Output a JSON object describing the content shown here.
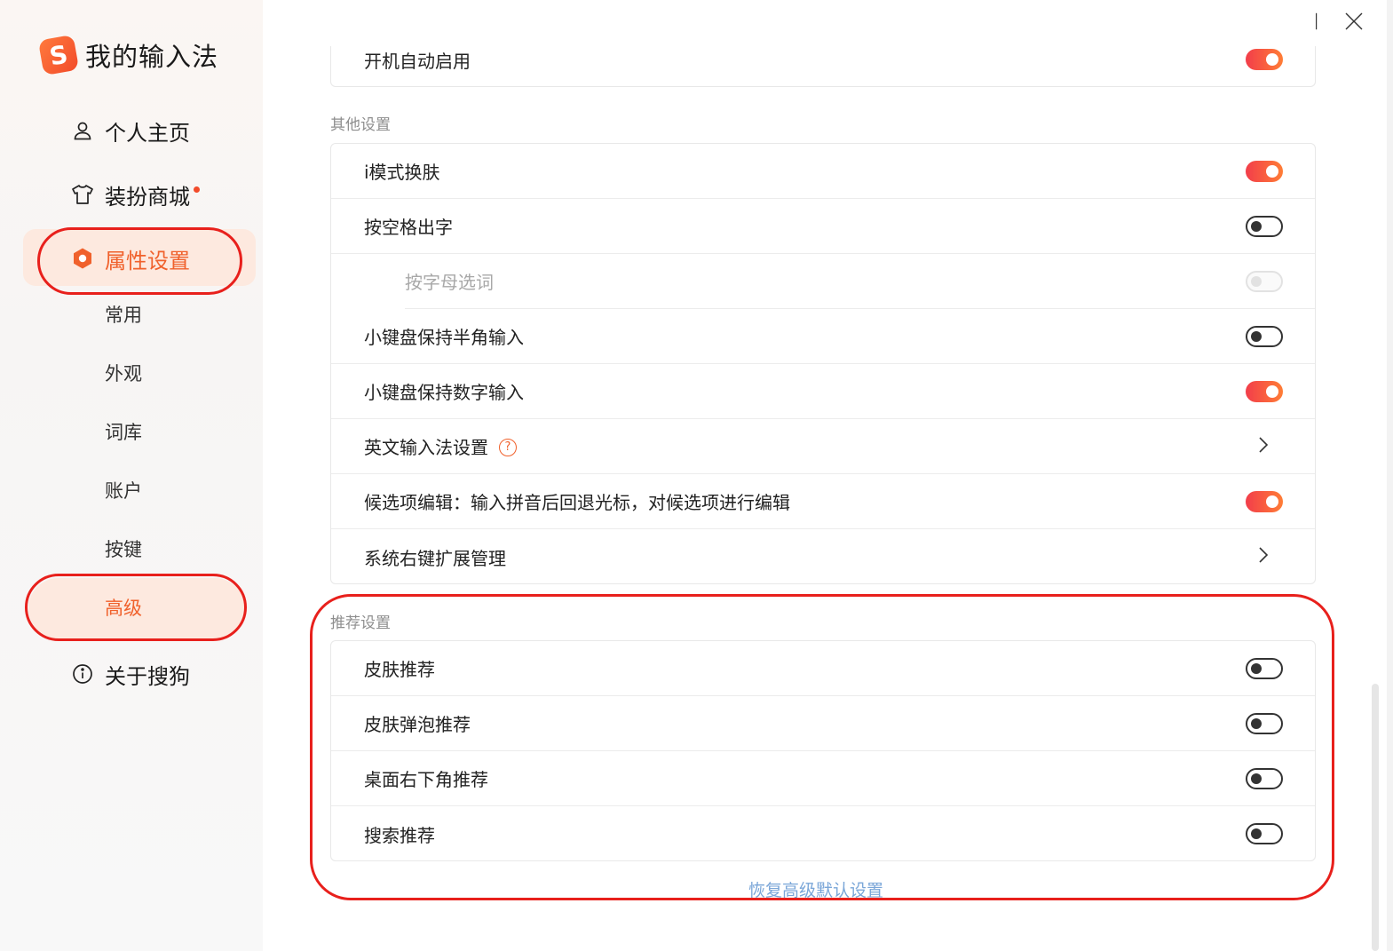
{
  "brand": {
    "logo_letter": "S",
    "title": "我的输入法"
  },
  "nav": {
    "profile": "个人主页",
    "store": "装扮商城",
    "settings": "属性设置",
    "about": "关于搜狗"
  },
  "subnav": [
    "常用",
    "外观",
    "词库",
    "账户",
    "按键",
    "高级"
  ],
  "top_partial_row": {
    "label": "开机自动启用",
    "toggle": "on"
  },
  "sections": {
    "other": {
      "title": "其他设置",
      "rows": [
        {
          "label": "i模式换肤",
          "control": "toggle",
          "state": "on"
        },
        {
          "label": "按空格出字",
          "control": "toggle",
          "state": "off"
        },
        {
          "label": "按字母选词",
          "control": "toggle",
          "state": "disabled"
        },
        {
          "label": "小键盘保持半角输入",
          "control": "toggle",
          "state": "off"
        },
        {
          "label": "小键盘保持数字输入",
          "control": "toggle",
          "state": "on"
        },
        {
          "label": "英文输入法设置",
          "control": "chevron",
          "help": "?"
        },
        {
          "label": "候选项编辑：输入拼音后回退光标，对候选项进行编辑",
          "control": "toggle",
          "state": "on"
        },
        {
          "label": "系统右键扩展管理",
          "control": "chevron"
        }
      ]
    },
    "recommend": {
      "title": "推荐设置",
      "rows": [
        {
          "label": "皮肤推荐",
          "control": "toggle",
          "state": "off"
        },
        {
          "label": "皮肤弹泡推荐",
          "control": "toggle",
          "state": "off"
        },
        {
          "label": "桌面右下角推荐",
          "control": "toggle",
          "state": "off"
        },
        {
          "label": "搜索推荐",
          "control": "toggle",
          "state": "off"
        }
      ]
    }
  },
  "restore_link": "恢复高级默认设置",
  "colors": {
    "accent": "#f0612c",
    "annotation": "#e8201c",
    "link": "#7aa6d8"
  },
  "icons": [
    "feedback-icon",
    "minimize-icon",
    "maximize-icon",
    "close-icon",
    "user-icon",
    "shirt-icon",
    "hexagon-settings-icon",
    "info-icon",
    "help-icon",
    "chevron-right-icon"
  ]
}
